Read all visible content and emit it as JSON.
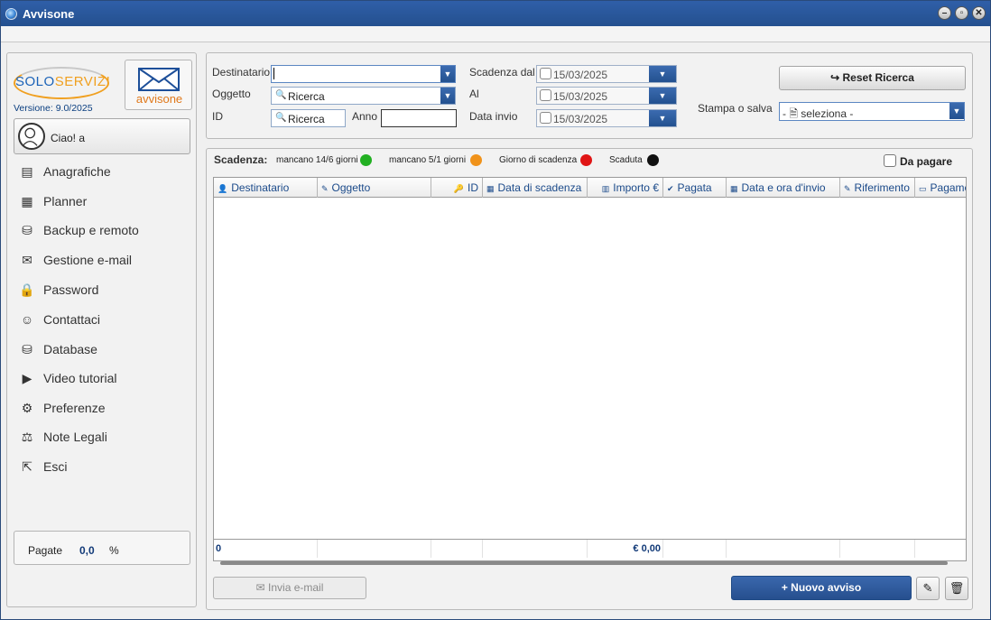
{
  "window": {
    "title": "Avvisone"
  },
  "brand": {
    "logo_left": "SOLO",
    "logo_right": "SERVIZI",
    "version": "Versione: 9.0/2025",
    "module": "avvisone"
  },
  "user": {
    "greeting": "Ciao! a"
  },
  "nav": [
    {
      "label": "Anagrafiche",
      "icon": "id-card-icon",
      "glyph": "▤"
    },
    {
      "label": "Planner",
      "icon": "calendar-icon",
      "glyph": "▦"
    },
    {
      "label": "Backup e remoto",
      "icon": "database-sync-icon",
      "glyph": "⛁"
    },
    {
      "label": "Gestione e-mail",
      "icon": "envelope-icon",
      "glyph": "✉"
    },
    {
      "label": "Password",
      "icon": "lock-icon",
      "glyph": "🔒"
    },
    {
      "label": "Contattaci",
      "icon": "person-icon",
      "glyph": "☺"
    },
    {
      "label": "Database",
      "icon": "database-icon",
      "glyph": "⛁"
    },
    {
      "label": "Video tutorial",
      "icon": "play-icon",
      "glyph": "▶"
    },
    {
      "label": "Preferenze",
      "icon": "gear-icon",
      "glyph": "⚙"
    },
    {
      "label": "Note Legali",
      "icon": "scales-icon",
      "glyph": "⚖"
    },
    {
      "label": "Esci",
      "icon": "exit-icon",
      "glyph": "⇱"
    }
  ],
  "stats": {
    "label": "Pagate",
    "value": "0,0",
    "unit": "%"
  },
  "filters": {
    "destinatario_label": "Destinatario",
    "destinatario_value": "",
    "oggetto_label": "Oggetto",
    "oggetto_placeholder": "Ricerca",
    "id_label": "ID",
    "id_placeholder": "Ricerca",
    "anno_label": "Anno",
    "anno_value": "",
    "scadenza_dal_label": "Scadenza dal",
    "scadenza_dal_value": "15/03/2025",
    "al_label": "Al",
    "al_value": "15/03/2025",
    "data_invio_label": "Data invio",
    "data_invio_value": "15/03/2025",
    "reset_label": "Reset Ricerca",
    "stampa_label": "Stampa o salva",
    "stampa_value": "- 🗎 seleziona -"
  },
  "legend": {
    "title": "Scadenza:",
    "items": [
      {
        "label": "mancano 14/6 giorni",
        "color": "#22b022"
      },
      {
        "label": "mancano 5/1 giorni",
        "color": "#f0921a"
      },
      {
        "label": "Giorno di scadenza",
        "color": "#e01515"
      },
      {
        "label": "Scaduta",
        "color": "#111111"
      }
    ]
  },
  "da_pagare_label": "Da pagare",
  "table": {
    "columns": [
      {
        "label": "Destinatario",
        "glyph": "👤"
      },
      {
        "label": "Oggetto",
        "glyph": "✎"
      },
      {
        "label": "ID",
        "glyph": "🔑"
      },
      {
        "label": "Data di scadenza",
        "glyph": "▦"
      },
      {
        "label": "Importo €",
        "glyph": "▥"
      },
      {
        "label": "Pagata",
        "glyph": "✔"
      },
      {
        "label": "Data e ora d'invio",
        "glyph": "▦"
      },
      {
        "label": "Riferimento",
        "glyph": "✎"
      },
      {
        "label": "Pagame",
        "glyph": "▭"
      }
    ],
    "rows": [],
    "footer_count": "0",
    "footer_total": "€ 0,00"
  },
  "actions": {
    "invia_label": "✉ Invia e-mail",
    "nuovo_label": "+ Nuovo avviso"
  }
}
